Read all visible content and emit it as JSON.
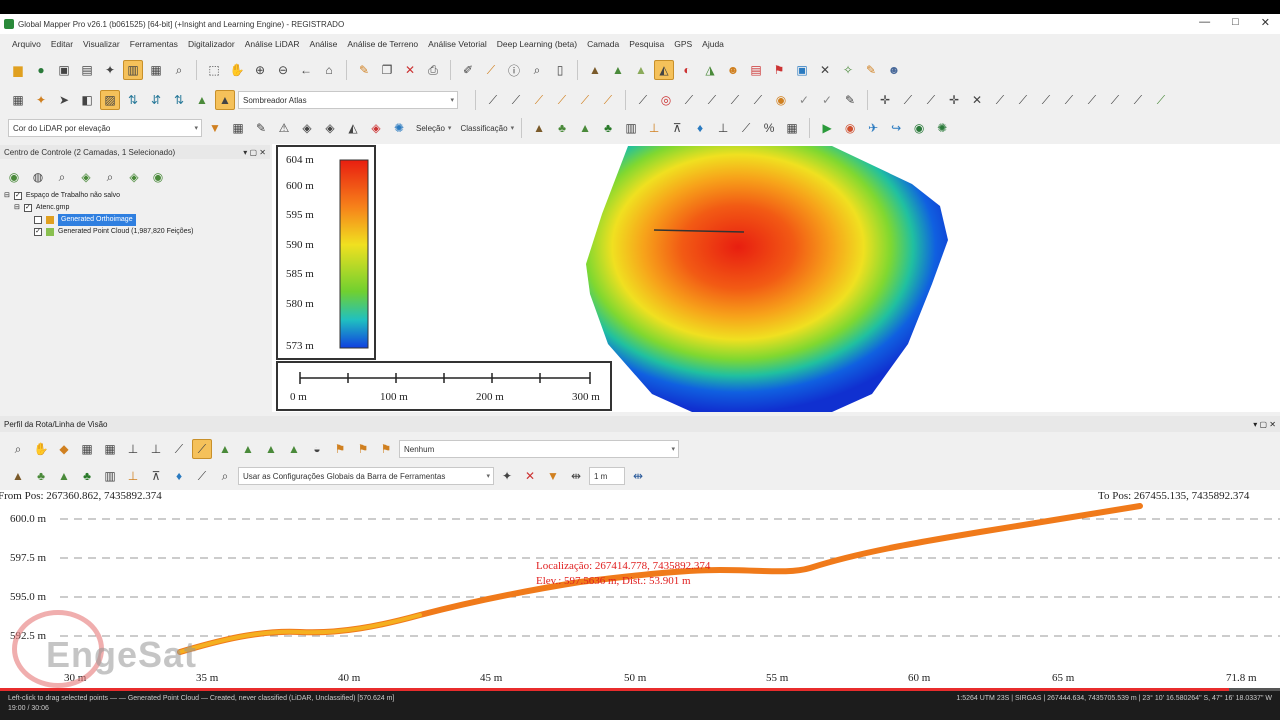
{
  "window": {
    "title": "Global Mapper Pro v26.1 (b061525) [64-bit] (+Insight and Learning Engine) - REGISTRADO",
    "controls": [
      "—",
      "□",
      "✕"
    ]
  },
  "menu": [
    "Arquivo",
    "Editar",
    "Visualizar",
    "Ferramentas",
    "Digitalizador",
    "Análise LiDAR",
    "Análise",
    "Análise de Terreno",
    "Análise Vetorial",
    "Deep Learning (beta)",
    "Camada",
    "Pesquisa",
    "GPS",
    "Ajuda"
  ],
  "toolbar2": {
    "shader_combo": "Sombreador Atlas"
  },
  "toolbar3": {
    "lidar_combo": "Cor do LiDAR por elevação",
    "selection_label": "Seleção",
    "classification_label": "Classificação"
  },
  "control_center": {
    "title": "Centro de Controle (2 Camadas, 1 Selecionado)",
    "workspace": "Espaço de Trabalho não salvo",
    "project": "Atenc.gmp",
    "layers": [
      "Generated Orthoimage",
      "Generated Point Cloud (1,987,820 Feições)"
    ]
  },
  "legend": {
    "labels": [
      "604 m",
      "600 m",
      "595 m",
      "590 m",
      "585 m",
      "580 m",
      "573 m"
    ],
    "values": [
      604,
      600,
      595,
      590,
      585,
      580,
      573
    ]
  },
  "scalebar": {
    "labels": [
      "0 m",
      "100 m",
      "200 m",
      "300 m"
    ]
  },
  "profile_panel": {
    "title": "Perfil da Rota/Linha de Visão",
    "combo": "Nenhum",
    "config_combo": "Usar as Configurações Globais da Barra de Ferramentas",
    "width_value": "1 m"
  },
  "profile": {
    "from_pos": "From Pos: 267360.862, 7435892.374",
    "to_pos": "To Pos: 267455.135, 7435892.374",
    "location": "Localização: 267414.778, 7435892.374",
    "elevation": "Elev.: 597.5636 m, Dist.: 53.901 m",
    "y_labels": [
      "600.0 m",
      "597.5 m",
      "595.0 m",
      "592.5 m"
    ],
    "x_labels": [
      "30 m",
      "35 m",
      "40 m",
      "45 m",
      "50 m",
      "55 m",
      "60 m",
      "65 m",
      "71.8 m"
    ]
  },
  "watermark": "EngeSat",
  "status": {
    "text": "Left-click to drag selected points — — Generated Point Cloud — Created, never classified (LiDAR, Unclassified) [570.624 m]",
    "right": "1:5264 UTM 23S | SIRGAS | 267444.634, 7435705.539 m | 23° 10' 16.580264\" S, 47° 16' 18.0337\" W",
    "time": "19:00 / 30:06",
    "progress_fraction": 0.96
  },
  "colors": {
    "accent": "#f5c15a",
    "selected": "#2f7fe0",
    "profile_line": "#f07a1a"
  }
}
